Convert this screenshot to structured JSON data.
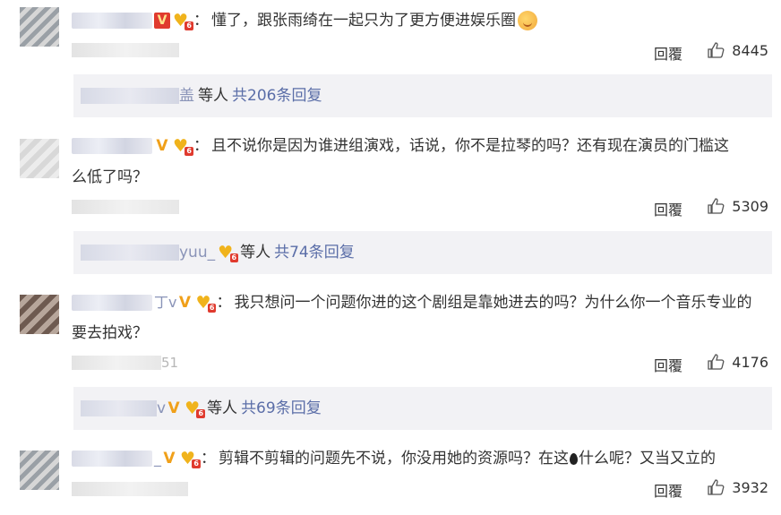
{
  "comments": [
    {
      "name_suffix": "",
      "text_line1": "懂了，跟张雨绮在一起只为了更方便进娱乐圈",
      "text_line2": "",
      "meta_suffix": "",
      "reply_label": "回覆",
      "likes": "8445",
      "replies": {
        "name_suffix": "盖",
        "others_label": "等人",
        "count_label": "共206条回复"
      }
    },
    {
      "name_suffix": "",
      "text_line1": "且不说你是因为谁进组演戏，话说，你不是拉琴的吗？还有现在演员的门槛这",
      "text_line2": "么低了吗？",
      "meta_suffix": "",
      "reply_label": "回覆",
      "likes": "5309",
      "replies": {
        "name_suffix": "yuu_",
        "others_label": "等人",
        "count_label": "共74条回复"
      }
    },
    {
      "name_suffix": "丁v",
      "text_line1": "我只想问一个问题你进的这个剧组是靠她进去的吗？为什么你一个音乐专业的",
      "text_line2": "要去拍戏？",
      "meta_suffix": "51",
      "reply_label": "回覆",
      "likes": "4176",
      "replies": {
        "name_suffix": "v",
        "others_label": "等人",
        "count_label": "共69条回复"
      }
    },
    {
      "name_suffix": "_",
      "text_line1": "剪辑不剪辑的问题先不说，你没用她的资源吗？在这",
      "text_line1b": "什么呢？又当又立的",
      "text_line2": "",
      "meta_suffix": "",
      "reply_label": "回覆",
      "likes": "3932"
    }
  ],
  "colon": "：",
  "badge_v": "V",
  "badge_level": "6",
  "heart_char": "♥",
  "icons": {
    "like": "thumbs-up-icon",
    "verify": "vip-v-icon",
    "fan-badge": "heart-badge-icon"
  }
}
